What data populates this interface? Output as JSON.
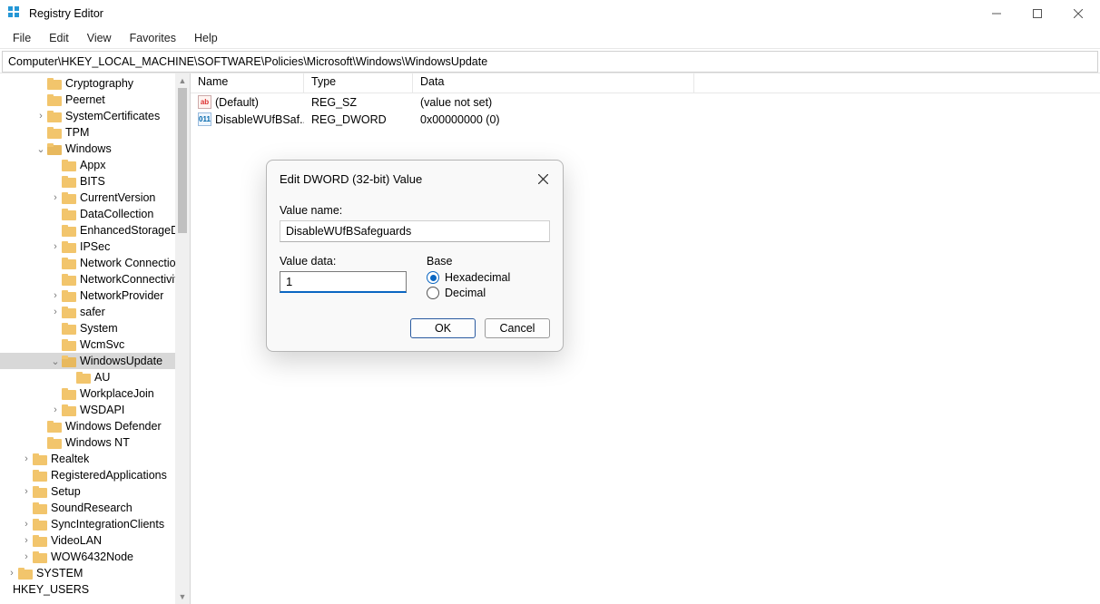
{
  "window": {
    "title": "Registry Editor"
  },
  "menus": {
    "file": "File",
    "edit": "Edit",
    "view": "View",
    "favorites": "Favorites",
    "help": "Help"
  },
  "address": "Computer\\HKEY_LOCAL_MACHINE\\SOFTWARE\\Policies\\Microsoft\\Windows\\WindowsUpdate",
  "columns": {
    "name": "Name",
    "type": "Type",
    "data": "Data"
  },
  "rows": [
    {
      "name": "(Default)",
      "type": "REG_SZ",
      "data": "(value not set)",
      "icon": "sz"
    },
    {
      "name": "DisableWUfBSaf...",
      "type": "REG_DWORD",
      "data": "0x00000000 (0)",
      "icon": "dw"
    }
  ],
  "tree": [
    {
      "depth": 2,
      "exp": "",
      "label": "Cryptography"
    },
    {
      "depth": 2,
      "exp": "",
      "label": "Peernet"
    },
    {
      "depth": 2,
      "exp": ">",
      "label": "SystemCertificates"
    },
    {
      "depth": 2,
      "exp": "",
      "label": "TPM"
    },
    {
      "depth": 2,
      "exp": "v",
      "label": "Windows",
      "open": true
    },
    {
      "depth": 3,
      "exp": "",
      "label": "Appx"
    },
    {
      "depth": 3,
      "exp": "",
      "label": "BITS"
    },
    {
      "depth": 3,
      "exp": ">",
      "label": "CurrentVersion"
    },
    {
      "depth": 3,
      "exp": "",
      "label": "DataCollection"
    },
    {
      "depth": 3,
      "exp": "",
      "label": "EnhancedStorageDevi"
    },
    {
      "depth": 3,
      "exp": ">",
      "label": "IPSec"
    },
    {
      "depth": 3,
      "exp": "",
      "label": "Network Connections"
    },
    {
      "depth": 3,
      "exp": "",
      "label": "NetworkConnectivityS"
    },
    {
      "depth": 3,
      "exp": ">",
      "label": "NetworkProvider"
    },
    {
      "depth": 3,
      "exp": ">",
      "label": "safer"
    },
    {
      "depth": 3,
      "exp": "",
      "label": "System"
    },
    {
      "depth": 3,
      "exp": "",
      "label": "WcmSvc"
    },
    {
      "depth": 3,
      "exp": "v",
      "label": "WindowsUpdate",
      "selected": true,
      "open": true
    },
    {
      "depth": 4,
      "exp": "",
      "label": "AU"
    },
    {
      "depth": 3,
      "exp": "",
      "label": "WorkplaceJoin"
    },
    {
      "depth": 3,
      "exp": ">",
      "label": "WSDAPI"
    },
    {
      "depth": 2,
      "exp": "",
      "label": "Windows Defender"
    },
    {
      "depth": 2,
      "exp": "",
      "label": "Windows NT"
    },
    {
      "depth": 1,
      "exp": ">",
      "label": "Realtek"
    },
    {
      "depth": 1,
      "exp": "",
      "label": "RegisteredApplications"
    },
    {
      "depth": 1,
      "exp": ">",
      "label": "Setup"
    },
    {
      "depth": 1,
      "exp": "",
      "label": "SoundResearch"
    },
    {
      "depth": 1,
      "exp": ">",
      "label": "SyncIntegrationClients"
    },
    {
      "depth": 1,
      "exp": ">",
      "label": "VideoLAN"
    },
    {
      "depth": 1,
      "exp": ">",
      "label": "WOW6432Node"
    },
    {
      "depth": 0,
      "exp": ">",
      "label": "SYSTEM"
    },
    {
      "depth": -1,
      "exp": "",
      "label": "HKEY_USERS",
      "nofolder": true
    }
  ],
  "dialog": {
    "title": "Edit DWORD (32-bit) Value",
    "valueNameLabel": "Value name:",
    "valueName": "DisableWUfBSafeguards",
    "valueDataLabel": "Value data:",
    "valueData": "1",
    "baseLabel": "Base",
    "hex": "Hexadecimal",
    "dec": "Decimal",
    "ok": "OK",
    "cancel": "Cancel"
  }
}
